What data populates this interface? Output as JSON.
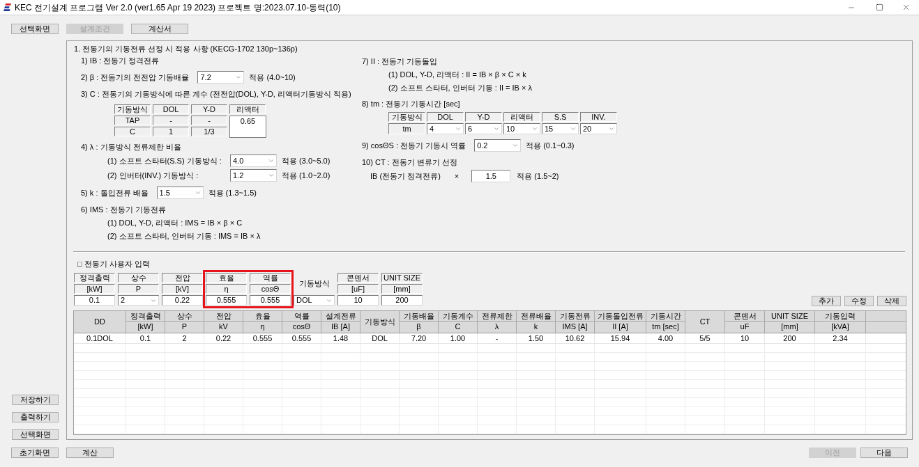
{
  "window": {
    "title": "KEC 전기설계 프로그램 Ver 2.0 (ver1.65 Apr 19 2023) 프로젝트 명:2023.07.10-동력(10)"
  },
  "nav_buttons": [
    {
      "label": "선택화면",
      "disabled": false
    },
    {
      "label": "설계조건",
      "disabled": true
    },
    {
      "label": "계산서",
      "disabled": false
    }
  ],
  "criteria": {
    "heading": "1. 전동기의 기동전류 선정 시 적용 사항 (KECG-1702 130p~136p)",
    "left": [
      {
        "kind": "line",
        "text": "1) IB : 전동기 정격전류"
      },
      {
        "kind": "select",
        "label": "2) β : 전동기의 전전압 기동배율",
        "value": "7.2",
        "note": "적용 (4.0~10)"
      },
      {
        "kind": "line",
        "text": "3) C : 전동기의 기동방식에 따른 계수 (전전압(DOL), Y-D, 리액터기동방식 적용)",
        "children": [
          {
            "kind": "coef_table",
            "columns": [
              "기동방식",
              "DOL",
              "Y-D",
              "리액터"
            ],
            "rows": [
              [
                "TAP",
                "-",
                "-"
              ],
              [
                "C",
                "1",
                "1/3"
              ]
            ],
            "merged_value": "0.65"
          }
        ]
      },
      {
        "kind": "line",
        "text": "4) λ : 기동방식 전류제한 비율",
        "children": [
          {
            "kind": "select",
            "label": "(1) 소프트 스타터(S.S) 기동방식 :",
            "value": "4.0",
            "note": "적용 (3.0~5.0)"
          },
          {
            "kind": "select",
            "label": "(2) 인버터(INV.) 기동방식 :",
            "value": "1.2",
            "note": "적용 (1.0~2.0)"
          }
        ]
      },
      {
        "kind": "select",
        "label": "5) k : 돌입전류 배율",
        "value": "1.5",
        "note": "적용 (1.3~1.5)"
      },
      {
        "kind": "line",
        "text": "6) IMS : 전동기 기동전류",
        "children": [
          {
            "kind": "line",
            "text": "(1) DOL, Y-D, 리액터 : IMS = IB × β × C"
          },
          {
            "kind": "line",
            "text": "(2) 소프트 스타터, 인버터 기동 : IMS = IB × λ"
          }
        ]
      }
    ],
    "right": [
      {
        "kind": "line",
        "text": "7) II : 전동기 기동돌입",
        "children": [
          {
            "kind": "line",
            "text": "(1) DOL, Y-D, 리액터 : II = IB × β × C × k"
          },
          {
            "kind": "line",
            "text": "(2) 소프트 스타터, 인버터 기동 : II = IB × λ"
          }
        ]
      },
      {
        "kind": "line",
        "text": "8) tm : 전동기 기동시간 [sec]",
        "children": [
          {
            "kind": "tm_table",
            "columns": [
              "기동방식",
              "DOL",
              "Y-D",
              "리액터",
              "S.S",
              "INV."
            ],
            "row_label": "tm",
            "values": [
              "4",
              "6",
              "10",
              "15",
              "20"
            ]
          }
        ]
      },
      {
        "kind": "select",
        "label": "9) cosΘS : 전동기 기동시 역률",
        "value": "0.2",
        "note": "적용 (0.1~0.3)"
      },
      {
        "kind": "line",
        "text": "10) CT : 전동기 변류기 선정",
        "children": [
          {
            "kind": "factor",
            "label": "IB (전동기 정격전류)",
            "operator": "×",
            "value": "1.5",
            "note": "적용 (1.5~2)"
          }
        ]
      }
    ]
  },
  "user_input": {
    "title": "□ 전동기 사용자 입력",
    "columns": [
      {
        "kind": "input",
        "label": "정격출력",
        "unit": "[kW]",
        "value": "0.1",
        "highlighted": false
      },
      {
        "kind": "select",
        "label": "상수",
        "unit": "P",
        "value": "2",
        "highlighted": false
      },
      {
        "kind": "input",
        "label": "전압",
        "unit": "[kV]",
        "value": "0.22",
        "highlighted": false
      },
      {
        "kind": "input",
        "label": "효율",
        "unit": "η",
        "value": "0.555",
        "highlighted": true
      },
      {
        "kind": "input",
        "label": "역률",
        "unit": "cosΘ",
        "value": "0.555",
        "highlighted": true
      },
      {
        "kind": "select",
        "label": "기동방식",
        "value": "DOL",
        "highlighted": false
      },
      {
        "kind": "input",
        "label": "콘덴서",
        "unit": "[uF]",
        "value": "10",
        "highlighted": false
      },
      {
        "kind": "input",
        "label": "UNIT SIZE",
        "unit": "[mm]",
        "value": "200",
        "highlighted": false
      }
    ],
    "buttons": [
      "추가",
      "수정",
      "삭제"
    ]
  },
  "table": {
    "columns": [
      {
        "label": "DD"
      },
      {
        "label": "정격출력",
        "unit": "[kW]"
      },
      {
        "label": "상수",
        "unit": "P"
      },
      {
        "label": "전압",
        "unit": "kV"
      },
      {
        "label": "효율",
        "unit": "η"
      },
      {
        "label": "역률",
        "unit": "cosΘ"
      },
      {
        "label": "설계전류",
        "unit": "IB [A]"
      },
      {
        "label": "기동방식"
      },
      {
        "label": "기동배율",
        "unit": "β"
      },
      {
        "label": "기동계수",
        "unit": "C"
      },
      {
        "label": "전류제한",
        "unit": "λ"
      },
      {
        "label": "전류배율",
        "unit": "k"
      },
      {
        "label": "기동전류",
        "unit": "IMS [A]"
      },
      {
        "label": "기동돌입전류",
        "unit": "II [A]"
      },
      {
        "label": "기동시간",
        "unit": "tm [sec]"
      },
      {
        "label": "CT"
      },
      {
        "label": "콘덴서",
        "unit": "uF"
      },
      {
        "label": "UNIT SIZE",
        "unit": "[mm]"
      },
      {
        "label": "기동입력",
        "unit": "[kVA]"
      }
    ],
    "rows": [
      [
        "0.1DOL",
        "0.1",
        "2",
        "0.22",
        "0.555",
        "0.555",
        "1.48",
        "DOL",
        "7.20",
        "1.00",
        "-",
        "1.50",
        "10.62",
        "15.94",
        "4.00",
        "5/5",
        "10",
        "200",
        "2.34"
      ]
    ]
  },
  "side_buttons": [
    "저장하기",
    "출력하기",
    "선택화면"
  ],
  "bottom_buttons": [
    "초기화면",
    "계산"
  ],
  "page_buttons": [
    {
      "label": "이전",
      "disabled": true
    },
    {
      "label": "다음",
      "disabled": false
    }
  ]
}
